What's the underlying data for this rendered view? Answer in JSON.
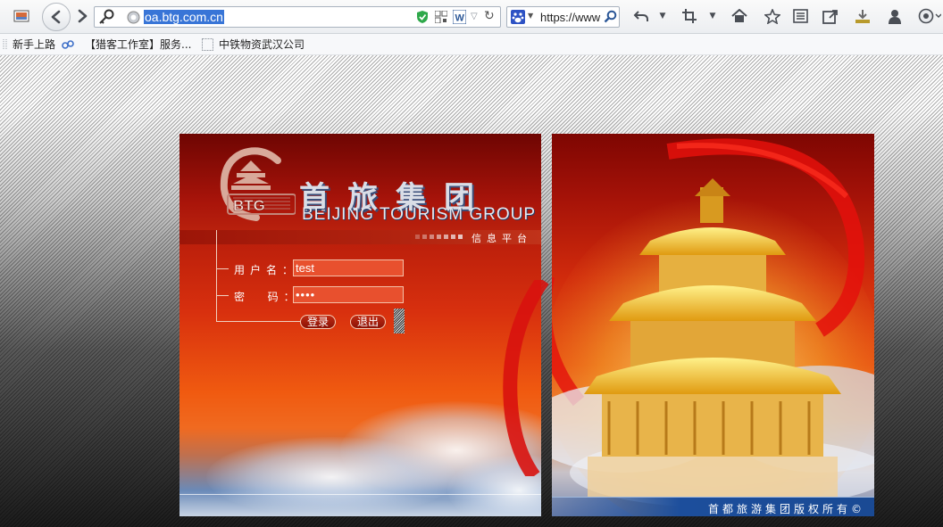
{
  "toolbar": {
    "url": "oa.btg.com.cn",
    "search_text": "https://www"
  },
  "bookmarks": [
    {
      "label": "新手上路"
    },
    {
      "label": "【猎客工作室】服务..."
    },
    {
      "label": "中铁物资武汉公司"
    }
  ],
  "brand": {
    "logo_text": "BTG",
    "name_cn": "首旅集团",
    "name_en": "BEIJING TOURISM GROUP",
    "subtitle": "信息平台"
  },
  "login": {
    "username_label": "用户名：",
    "username_value": "test",
    "password_label": "密  码：",
    "password_value": "••••",
    "login_button": "登录",
    "exit_button": "退出"
  },
  "footer": {
    "copyright": "首都旅游集团版权所有©"
  },
  "colors": {
    "accent_red": "#b0180a",
    "url_selection": "#3875d7",
    "footer_blue": "#1c4e9c"
  },
  "icons": [
    "site-identity-icon",
    "back-icon",
    "forward-icon",
    "key-icon",
    "globe-icon",
    "shield-icon",
    "qr-icon",
    "word-icon",
    "dropdown-icon",
    "reload-icon",
    "baidu-icon",
    "search-icon",
    "undo-icon",
    "crop-icon",
    "home-icon",
    "star-icon",
    "reader-icon",
    "share-icon",
    "download-icon",
    "user-icon",
    "menu-icon"
  ]
}
